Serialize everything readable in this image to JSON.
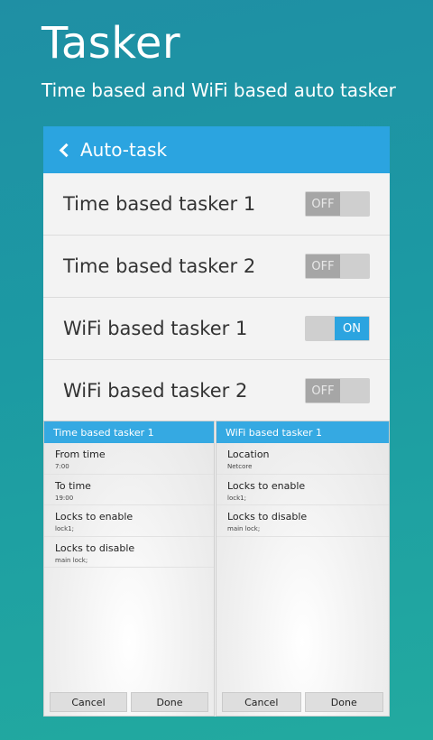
{
  "promo": {
    "title": "Tasker",
    "subtitle": "Time based and WiFi based auto tasker"
  },
  "appbar": {
    "back_icon": "chevron-left-icon",
    "title": "Auto-task"
  },
  "taskers": [
    {
      "label": "Time based tasker 1",
      "state": "OFF"
    },
    {
      "label": "Time based tasker 2",
      "state": "OFF"
    },
    {
      "label": "WiFi based tasker 1",
      "state": "ON"
    },
    {
      "label": "WiFi based tasker 2",
      "state": "OFF"
    }
  ],
  "time_dialog": {
    "title": "Time based tasker 1",
    "fields": [
      {
        "label": "From time",
        "value": "7:00"
      },
      {
        "label": "To time",
        "value": "19:00"
      },
      {
        "label": "Locks to enable",
        "value": "lock1;"
      },
      {
        "label": "Locks to disable",
        "value": "main lock;"
      }
    ],
    "cancel": "Cancel",
    "done": "Done"
  },
  "wifi_dialog": {
    "title": "WiFi based tasker 1",
    "fields": [
      {
        "label": "Location",
        "value": "Netcore"
      },
      {
        "label": "Locks to enable",
        "value": "lock1;"
      },
      {
        "label": "Locks to disable",
        "value": "main lock;"
      }
    ],
    "cancel": "Cancel",
    "done": "Done"
  },
  "colors": {
    "accent": "#2ba4e0",
    "background_top": "#1f8fa4",
    "background_bottom": "#22aaa0"
  }
}
